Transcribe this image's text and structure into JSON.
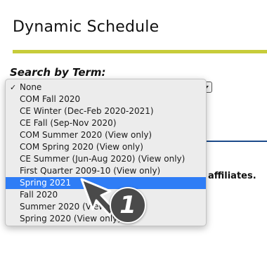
{
  "page": {
    "title": "Dynamic Schedule",
    "search_label": "Search by Term:",
    "affiliates_text": "affiliates."
  },
  "dropdown": {
    "check_glyph": "✓",
    "items": [
      {
        "label": "None",
        "checked": true
      },
      {
        "label": "COM Fall 2020"
      },
      {
        "label": "CE Winter (Dec-Feb 2020-2021)"
      },
      {
        "label": "CE Fall (Sep-Nov 2020)"
      },
      {
        "label": "COM Summer 2020 (View only)"
      },
      {
        "label": "COM Spring 2020 (View only)"
      },
      {
        "label": "CE Summer (Jun-Aug 2020) (View only)"
      },
      {
        "label": "First Quarter 2009-10 (View only)"
      },
      {
        "label": "Spring 2021",
        "highlighted": true
      },
      {
        "label": "Fall 2020"
      },
      {
        "label": "Summer 2020 (View only)"
      },
      {
        "label": "Spring 2020 (View only)"
      }
    ]
  },
  "annotation": {
    "step_number": "1",
    "cursor_icon": "arrow-pointer-icon"
  },
  "colors": {
    "title_rule": "#c7cc3a",
    "highlight": "#2f7df6",
    "blue_rule": "#1c4a8a",
    "badge": "#4a4a4a"
  }
}
